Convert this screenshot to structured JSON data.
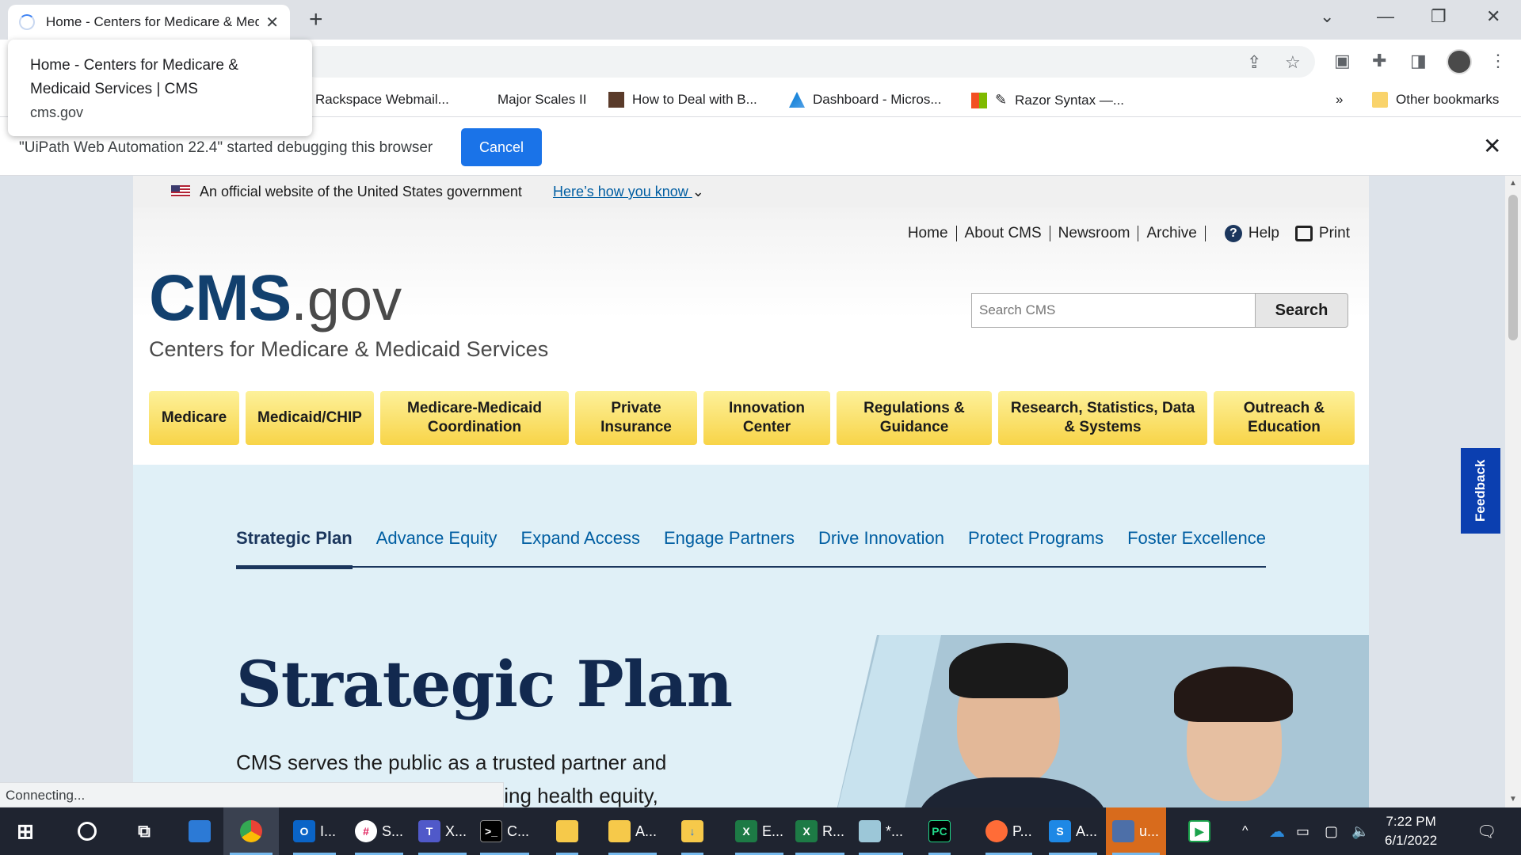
{
  "browser": {
    "tab_title": "Home - Centers for Medicare & Medicaid Services | CMS",
    "hovercard": {
      "title": "Home - Centers for Medicare & Medicaid Services | CMS",
      "url": "cms.gov"
    },
    "bookmarks": [
      {
        "label": "Rackspace Webmail...",
        "icon": "rackspace-icon"
      },
      {
        "label": "Major Scales II",
        "icon": ""
      },
      {
        "label": "How to Deal with B...",
        "icon": "book-icon"
      },
      {
        "label": "Dashboard - Micros...",
        "icon": "azure-icon"
      },
      {
        "label": "Razor Syntax —...",
        "icon": "pencil-icon"
      }
    ],
    "bookmarks_overflow": "»",
    "other_bookmarks": "Other bookmarks",
    "infobar": {
      "message": "\"UiPath Web Automation 22.4\" started debugging this browser",
      "cancel_label": "Cancel"
    },
    "status_text": "Connecting..."
  },
  "gov_banner": {
    "official": "An official website of the United States government",
    "how_you_know": "Here’s how you know"
  },
  "header": {
    "util_links": [
      "Home",
      "About CMS",
      "Newsroom",
      "Archive"
    ],
    "help": "Help",
    "print": "Print",
    "logo_cms": "CMS",
    "logo_gov": ".gov",
    "logo_subtitle": "Centers for Medicare & Medicaid Services",
    "search_placeholder": "Search CMS",
    "search_button": "Search"
  },
  "main_nav": [
    "Medicare",
    "Medicaid/CHIP",
    "Medicare-Medicaid Coordination",
    "Private Insurance",
    "Innovation Center",
    "Regulations & Guidance",
    "Research, Statistics, Data & Systems",
    "Outreach & Education"
  ],
  "strategic": {
    "tabs": [
      "Strategic Plan",
      "Advance Equity",
      "Expand Access",
      "Engage Partners",
      "Drive Innovation",
      "Protect Programs",
      "Foster Excellence"
    ],
    "active_tab": "Strategic Plan",
    "title": "Strategic Plan",
    "body": "CMS serves the public as a trusted partner and steward, dedicated to advancing health equity,"
  },
  "feedback_label": "Feedback",
  "taskbar": {
    "apps": [
      {
        "label": "I...",
        "icon": "outlook-icon"
      },
      {
        "label": "S...",
        "icon": "slack-icon"
      },
      {
        "label": "X...",
        "icon": "teams-icon"
      },
      {
        "label": "C...",
        "icon": "terminal-icon"
      },
      {
        "label": "",
        "icon": "folder-icon"
      },
      {
        "label": "A...",
        "icon": "folder-icon"
      },
      {
        "label": "",
        "icon": "downloads-icon"
      },
      {
        "label": "E...",
        "icon": "excel-icon"
      },
      {
        "label": "R...",
        "icon": "excel-icon"
      },
      {
        "label": "*...",
        "icon": "notepad-icon"
      },
      {
        "label": "",
        "icon": "pycharm-icon"
      },
      {
        "label": "P...",
        "icon": "postman-icon"
      },
      {
        "label": "A...",
        "icon": "app-icon"
      },
      {
        "label": "u...",
        "icon": "uipath-icon"
      }
    ],
    "time": "7:22 PM",
    "date": "6/1/2022"
  },
  "colors": {
    "cms_navy": "#12406e",
    "nav_yellow": "#f8d448",
    "link_blue": "#005ea2",
    "chrome_blue": "#1a73e8",
    "feedback_blue": "#0b3fb0"
  }
}
